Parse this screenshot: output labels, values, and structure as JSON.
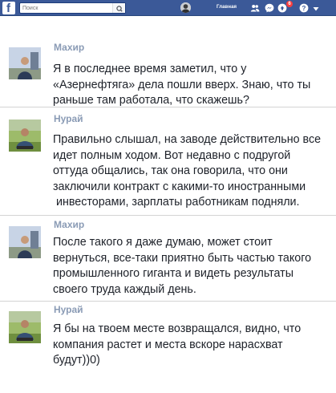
{
  "topbar": {
    "search_placeholder": "Поиск",
    "home_label": "Главная",
    "notification_count": "6",
    "icons": [
      "facebook-logo-icon",
      "search-icon",
      "friends-icon",
      "messenger-icon",
      "notifications-icon",
      "help-icon",
      "dropdown-icon"
    ]
  },
  "colors": {
    "topbar": "#3b5998",
    "name": "#8a9bb5",
    "badge": "#fa3e3e"
  },
  "messages": [
    {
      "author": "Махир",
      "lines": [
        "Я в последнее время заметил, что у",
        "«Азернефтяга» дела пошли вверх. Знаю, что ты",
        "раньше там работала, что скажешь?"
      ]
    },
    {
      "author": "Нурай",
      "lines": [
        "Правильно слышал, на заводе действительно все",
        "идет полным ходом. Вот недавно с подругой",
        "оттуда общались, так она говорила, что они",
        "заключили контракт с какими-то иностранными",
        " инвесторами, зарплаты работникам подняли."
      ]
    },
    {
      "author": "Махир",
      "lines": [
        "После такого я даже думаю, может стоит",
        "вернуться, все-таки приятно быть частью такого",
        "промышленного гиганта и видеть результаты",
        "своего труда каждый день."
      ]
    },
    {
      "author": "Нурай",
      "lines": [
        "Я бы на твоем месте возвращался, видно, что",
        "компания растет и места вскоре нарасхват",
        "будут))0)"
      ]
    }
  ]
}
